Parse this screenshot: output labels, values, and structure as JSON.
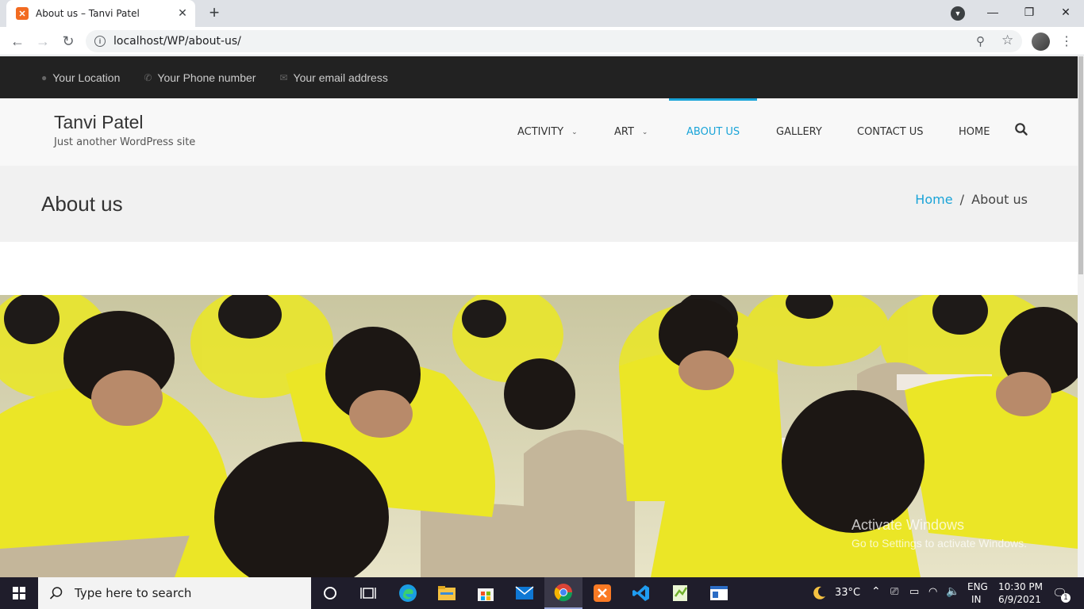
{
  "browser": {
    "tab_title": "About us – Tanvi Patel",
    "url": "localhost/WP/about-us/"
  },
  "topbar": {
    "location": "Your Location",
    "phone": "Your Phone number",
    "email": "Your email address"
  },
  "site": {
    "title": "Tanvi Patel",
    "tagline": "Just another WordPress site"
  },
  "nav": {
    "items": [
      {
        "label": "ACTIVITY"
      },
      {
        "label": "ART"
      },
      {
        "label": "ABOUT US"
      },
      {
        "label": "GALLERY"
      },
      {
        "label": "CONTACT US"
      },
      {
        "label": "HOME"
      }
    ],
    "active": "ABOUT US"
  },
  "page": {
    "title": "About us",
    "breadcrumb": {
      "home": "Home",
      "separator": "/",
      "current": "About us"
    }
  },
  "watermark": {
    "line1": "Activate Windows",
    "line2": "Go to Settings to activate Windows."
  },
  "taskbar": {
    "search_placeholder": "Type here to search",
    "weather": "33°C",
    "language": "ENG",
    "region": "IN",
    "time": "10:30 PM",
    "date": "6/9/2021",
    "notification_count": "1"
  },
  "colors": {
    "accent": "#1aa4d8",
    "topbar_bg": "#222222",
    "header_bg": "#f8f8f8",
    "page_head_bg": "#f1f1f1"
  }
}
